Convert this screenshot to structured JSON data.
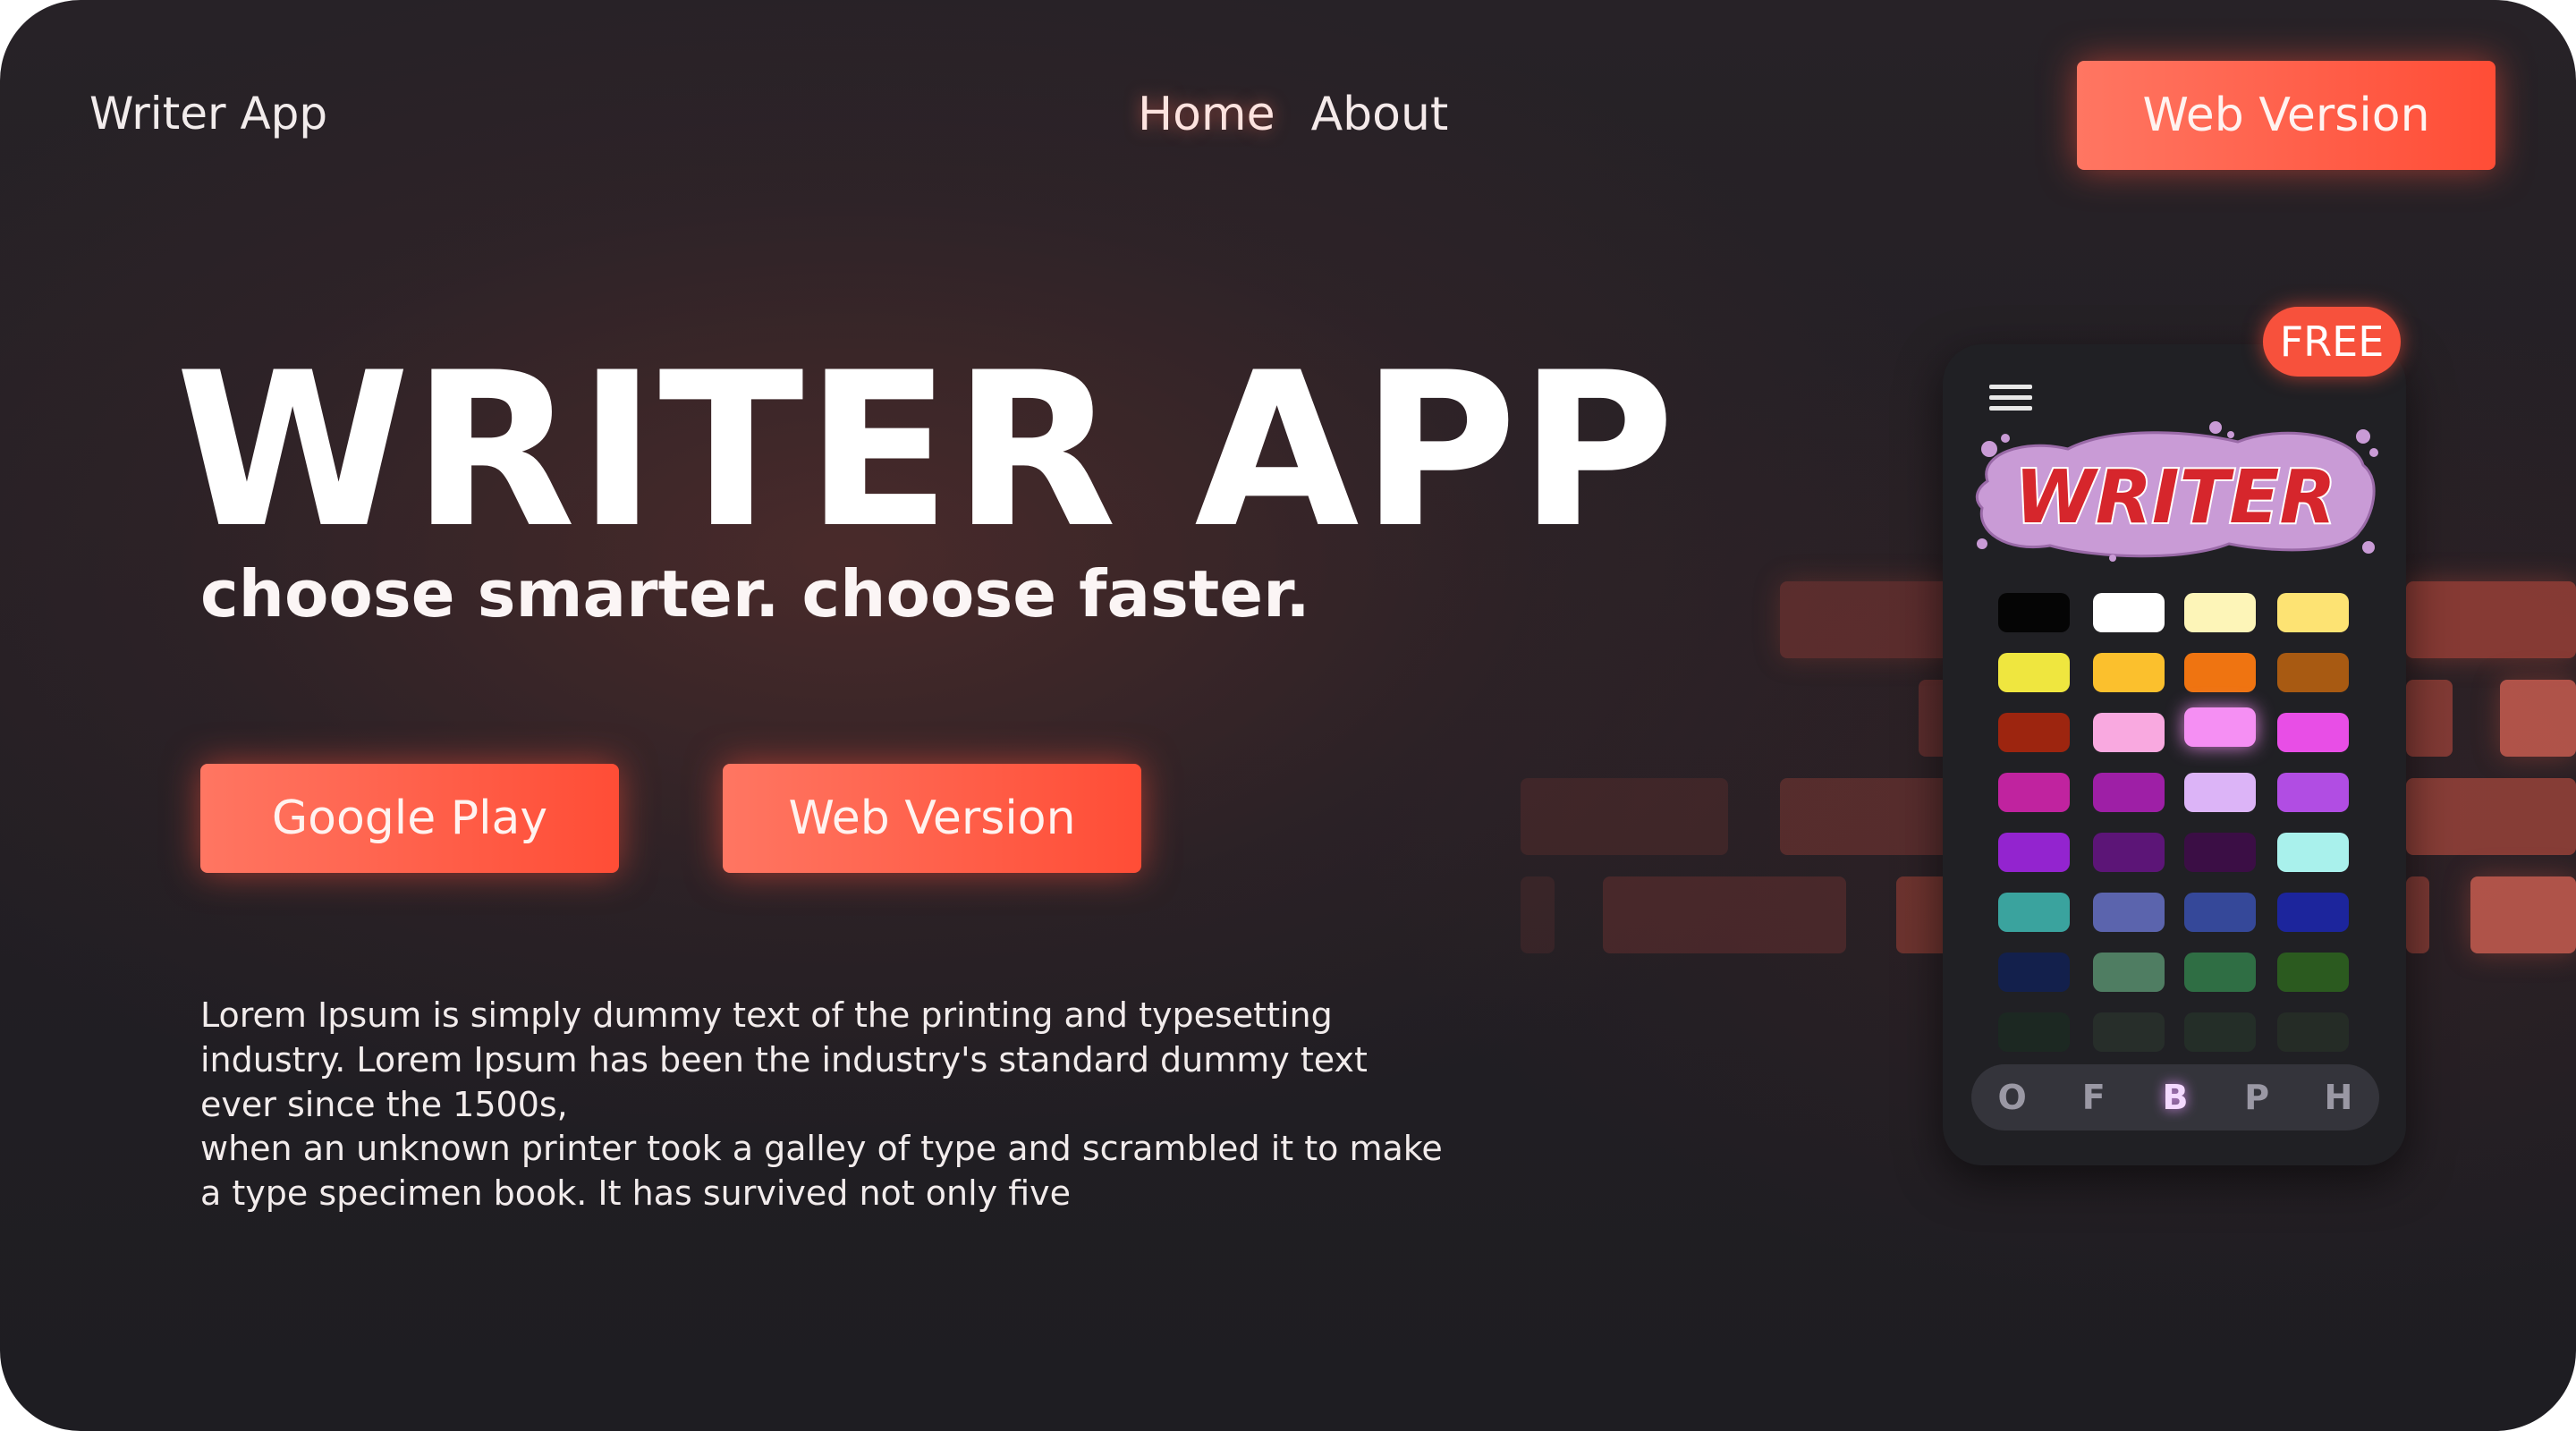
{
  "header": {
    "logo": "Writer App",
    "nav": [
      {
        "label": "Home",
        "active": true
      },
      {
        "label": "About",
        "active": false
      }
    ],
    "cta_label": "Web Version"
  },
  "hero": {
    "title": "WRITER APP",
    "tagline": "choose smarter. choose faster.",
    "buttons": {
      "google_play": "Google Play",
      "web_version": "Web Version"
    },
    "paragraph_1": "Lorem Ipsum is simply dummy text of the printing and typesetting industry. Lorem Ipsum has been the industry's standard dummy text ever since the 1500s,",
    "paragraph_2": "when an unknown printer took a galley of type and scrambled it to make a type specimen book. It has survived not only five"
  },
  "phone": {
    "badge": "FREE",
    "logo_text": "WRITER",
    "menu_icon": "hamburger-menu-icon",
    "swatch_rows": [
      [
        "#050505",
        "#ffffff",
        "#fdf5b8",
        "#fde373"
      ],
      [
        "#efe63f",
        "#fbc02d",
        "#ef7411",
        "#a85a12"
      ],
      [
        "#9d250f",
        "#f9a9e0",
        "#f58ff3",
        "#e84ee6"
      ],
      [
        "#c0239f",
        "#9e1fa6",
        "#dcb4f7",
        "#b14de3"
      ],
      [
        "#9324cf",
        "#5c1577",
        "#3b0e45",
        "#a9f1ec"
      ],
      [
        "#3aa39e",
        "#5b64ad",
        "#354899",
        "#1c259c"
      ],
      [
        "#13204c",
        "#4f7d62",
        "#2f6e44",
        "#2b5a1f"
      ],
      [
        "#1a3021",
        "#2d3a2f",
        "#283a2c",
        "#2a3728"
      ]
    ],
    "selected_swatch": "#f58ff3",
    "tabs": [
      {
        "label": "O",
        "active": false
      },
      {
        "label": "F",
        "active": false
      },
      {
        "label": "B",
        "active": true
      },
      {
        "label": "P",
        "active": false
      },
      {
        "label": "H",
        "active": false
      }
    ]
  },
  "colors": {
    "accent": "#ff5a42",
    "background": "#231f24"
  }
}
